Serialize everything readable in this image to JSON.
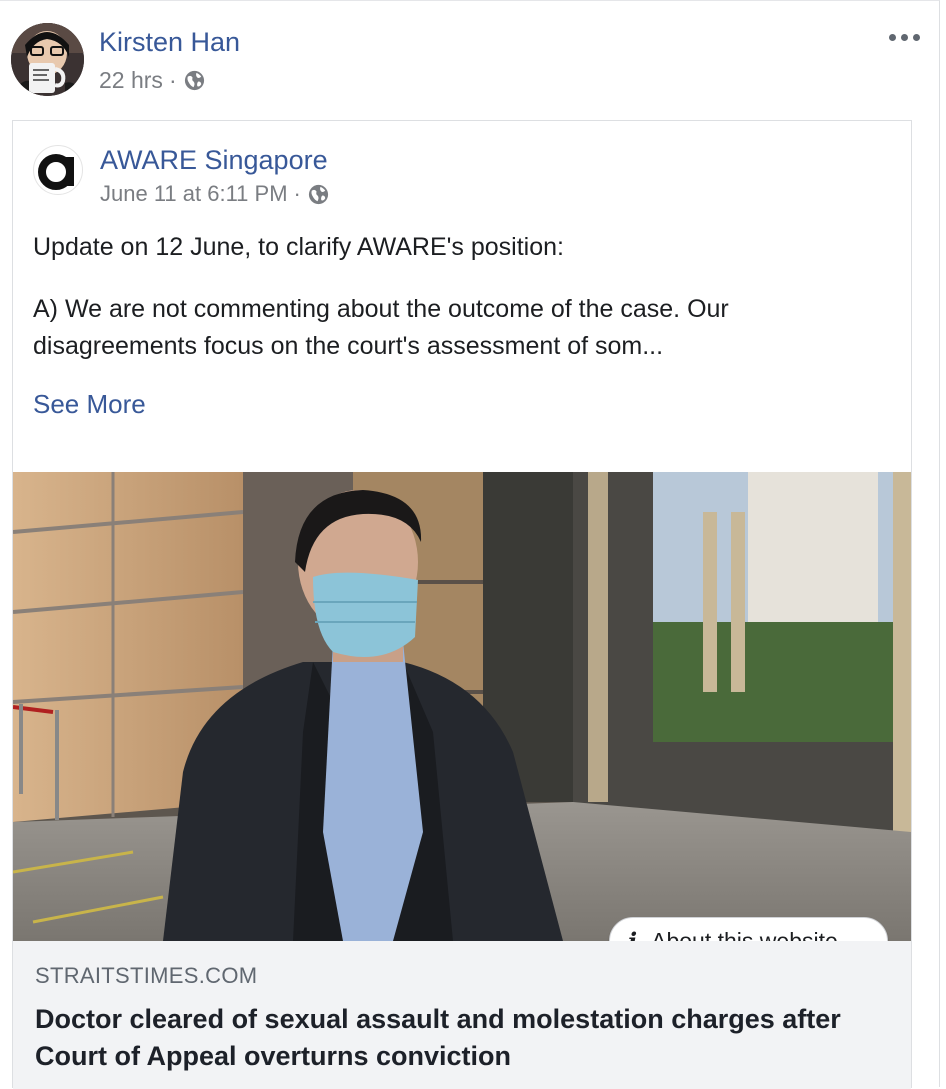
{
  "post": {
    "author": "Kirsten Han",
    "time": "22 hrs",
    "separator": "·"
  },
  "shared": {
    "page_name": "AWARE Singapore",
    "time": "June 11 at 6:11 PM",
    "separator": "·",
    "text_line1": "Update on 12 June, to clarify AWARE's position:",
    "text_line2": "A) We are not commenting about the outcome of the case. Our disagreements focus on the court's assessment of som...",
    "see_more": "See More"
  },
  "link": {
    "about_label": "About this website",
    "domain": "STRAITSTIMES.COM",
    "title": "Doctor cleared of sexual assault and molestation charges after Court of Appeal overturns conviction"
  },
  "colors": {
    "link_blue": "#385898",
    "meta_gray": "#7a7d82",
    "footer_bg": "#f2f3f5"
  },
  "icons": [
    "globe-icon",
    "more-dots-icon",
    "info-icon"
  ]
}
